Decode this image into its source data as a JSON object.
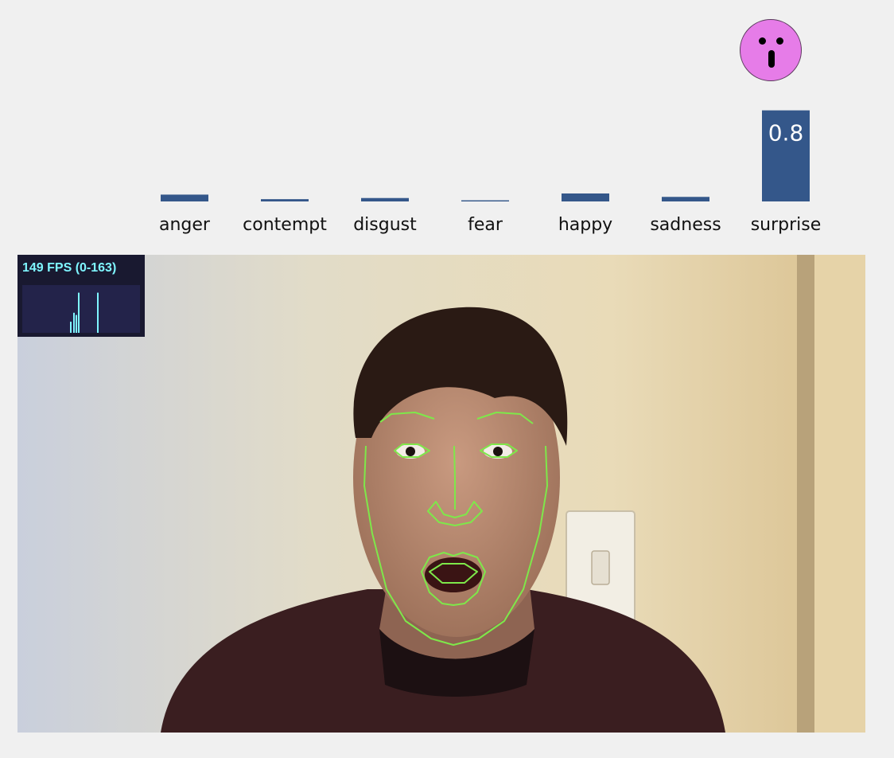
{
  "chart_data": {
    "type": "bar",
    "categories": [
      "anger",
      "contempt",
      "disgust",
      "fear",
      "happy",
      "sadness",
      "surprise"
    ],
    "values": [
      0.06,
      0.02,
      0.03,
      0.01,
      0.07,
      0.04,
      0.8
    ],
    "value_labels": [
      "",
      "",
      "",
      "",
      "",
      "",
      "0.8"
    ],
    "bar_color": "#34578a",
    "label_color": "#ffffff",
    "highlighted_category": "surprise"
  },
  "emoji": {
    "expression": "surprised-face-icon",
    "color": "#e67ce8"
  },
  "fps_meter": {
    "label": "149 FPS (0-163)",
    "text_color": "#7ff6ff",
    "background": "#191930",
    "graph_color": "#23234a",
    "bars": [
      0.25,
      0.45,
      0.4,
      0.9,
      0.9
    ]
  },
  "face_overlay": {
    "line_color": "#7ee84a"
  }
}
